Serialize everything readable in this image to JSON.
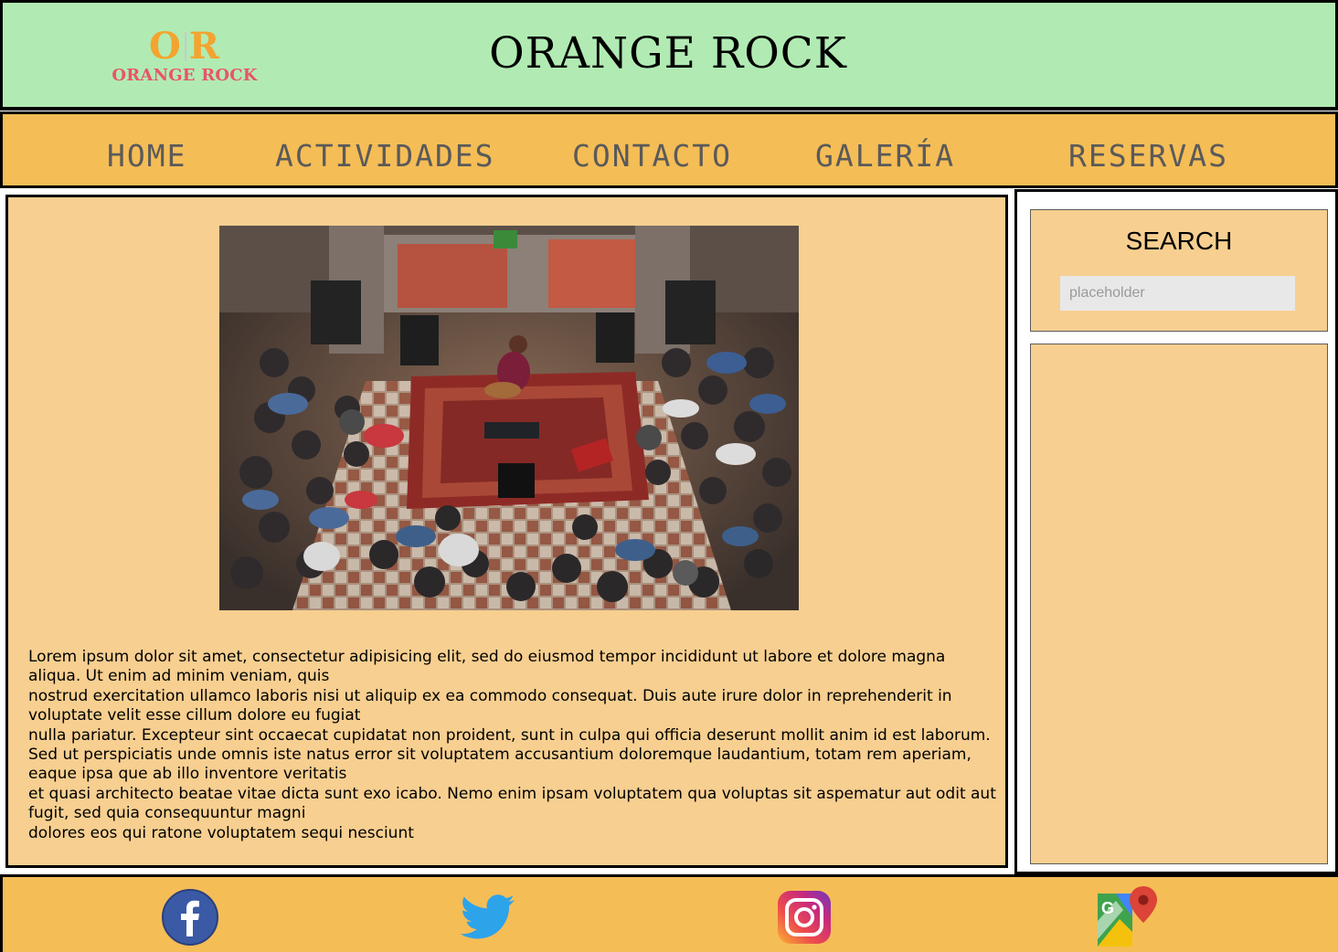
{
  "header": {
    "logo_mark_left": "O",
    "logo_mark_right": "R",
    "logo_text": "ORANGE ROCK",
    "title": "ORANGE ROCK"
  },
  "nav": {
    "items": [
      {
        "label": "HOME"
      },
      {
        "label": "ACTIVIDADES"
      },
      {
        "label": "CONTACTO"
      },
      {
        "label": "GALERÍA"
      },
      {
        "label": "RESERVAS"
      }
    ]
  },
  "main": {
    "image_alt": "concert photo",
    "paragraphs": [
      "Lorem ipsum dolor sit amet, consectetur adipisicing elit, sed do eiusmod tempor incididunt ut labore et dolore magna aliqua. Ut enim ad minim veniam, quis",
      "nostrud exercitation ullamco laboris nisi ut aliquip ex ea commodo consequat. Duis aute irure dolor in reprehenderit in voluptate velit esse cillum dolore eu fugiat",
      "nulla pariatur. Excepteur sint occaecat cupidatat non proident, sunt in culpa qui officia deserunt mollit anim id est laborum.",
      "Sed ut perspiciatis unde omnis iste natus error sit voluptatem accusantium doloremque laudantium, totam rem aperiam, eaque ipsa que ab illo inventore veritatis",
      "et quasi architecto beatae vitae dicta sunt exo icabo. Nemo enim ipsam voluptatem qua voluptas sit aspematur aut odit aut fugit, sed quia consequuntur magni",
      "dolores eos qui ratone voluptatem sequi nesciunt"
    ]
  },
  "sidebar": {
    "search_title": "SEARCH",
    "search_placeholder": "placeholder"
  },
  "footer": {
    "icons": [
      "facebook-icon",
      "twitter-icon",
      "instagram-icon",
      "google-maps-icon"
    ]
  },
  "colors": {
    "header_bg": "#b1ebb3",
    "nav_bg": "#f5bd56",
    "content_bg": "#f7cf90",
    "logo_orange": "#f3a430",
    "logo_red": "#e8556a"
  }
}
